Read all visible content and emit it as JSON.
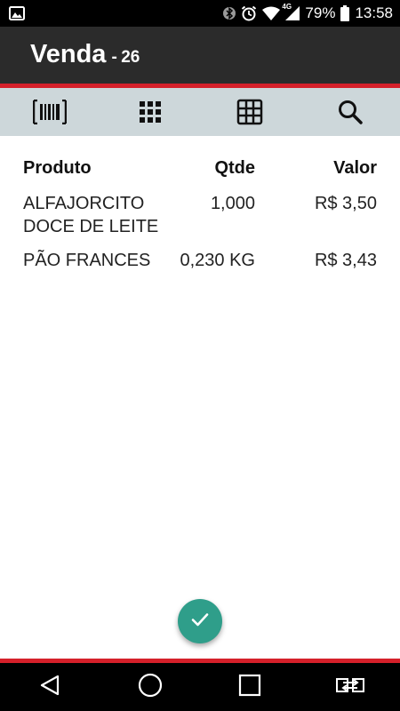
{
  "status_bar": {
    "network": "4G",
    "battery": "79%",
    "time": "13:58"
  },
  "app_bar": {
    "title": "Venda",
    "separator": "-",
    "sale_number": "26"
  },
  "toolbar": {
    "icons": [
      "barcode-icon",
      "keypad-icon",
      "grid-icon",
      "search-icon"
    ]
  },
  "table": {
    "headers": {
      "product": "Produto",
      "qty": "Qtde",
      "value": "Valor"
    },
    "rows": [
      {
        "product": "ALFAJORCITO DOCE DE LEITE",
        "qty": "1,000",
        "value": "R$ 3,50"
      },
      {
        "product": "PÃO FRANCES",
        "qty": "0,230 KG",
        "value": "R$ 3,43"
      }
    ]
  },
  "colors": {
    "status_bar": "#000000",
    "app_bar": "#2b2b2b",
    "accent_line": "#d5202a",
    "toolbar": "#cdd7da",
    "fab": "#2f9e8a",
    "nav_bar": "#000000"
  }
}
